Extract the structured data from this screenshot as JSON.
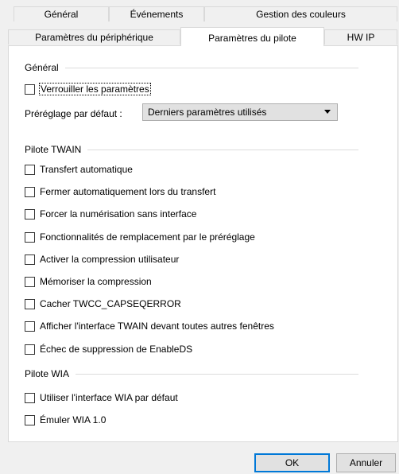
{
  "tabs": {
    "row1": [
      "Général",
      "Événements",
      "Gestion des couleurs"
    ],
    "row2": [
      "Paramètres du périphérique",
      "Paramètres du pilote",
      "HW IP"
    ],
    "active": "Paramètres du pilote"
  },
  "general": {
    "title": "Général",
    "lock_label": "Verrouiller les paramètres",
    "preset_label": "Préréglage par défaut :",
    "preset_value": "Derniers paramètres utilisés"
  },
  "twain": {
    "title": "Pilote TWAIN",
    "options": [
      "Transfert automatique",
      "Fermer automatiquement lors du transfert",
      "Forcer la numérisation sans interface",
      "Fonctionnalités de remplacement par le préréglage",
      "Activer la compression utilisateur",
      "Mémoriser la compression",
      "Cacher TWCC_CAPSEQERROR",
      "Afficher l'interface TWAIN devant toutes autres fenêtres",
      "Échec de suppression de EnableDS"
    ]
  },
  "wia": {
    "title": "Pilote WIA",
    "options": [
      "Utiliser l'interface WIA par défaut",
      "Émuler WIA 1.0"
    ]
  },
  "buttons": {
    "ok": "OK",
    "cancel": "Annuler"
  }
}
